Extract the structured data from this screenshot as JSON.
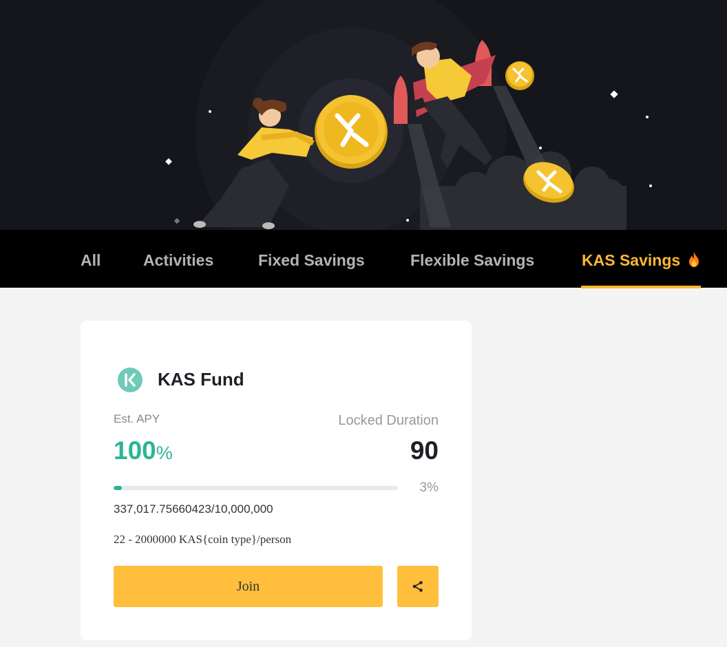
{
  "tabs": [
    {
      "label": "All",
      "active": false
    },
    {
      "label": "Activities",
      "active": false
    },
    {
      "label": "Fixed Savings",
      "active": false
    },
    {
      "label": "Flexible Savings",
      "active": false
    },
    {
      "label": "KAS Savings",
      "active": true,
      "icon": "flame-icon"
    }
  ],
  "card": {
    "coin_icon": "kas-coin-icon",
    "title": "KAS Fund",
    "apy_label": "Est. APY",
    "apy_value": "100",
    "apy_unit": "%",
    "duration_label": "Locked Duration",
    "duration_value": "90",
    "progress_fraction": 0.03,
    "progress_percent": "3%",
    "amount": "337,017.75660423/10,000,000",
    "limit": "22 - 2000000 KAS{coin type}/person",
    "join_label": "Join",
    "share_icon": "share-icon"
  },
  "colors": {
    "accent": "#ffb833",
    "button": "#ffbe3c",
    "apy_green": "#2ab694",
    "tab_bar": "#000000",
    "hero_bg": "#15161b"
  }
}
